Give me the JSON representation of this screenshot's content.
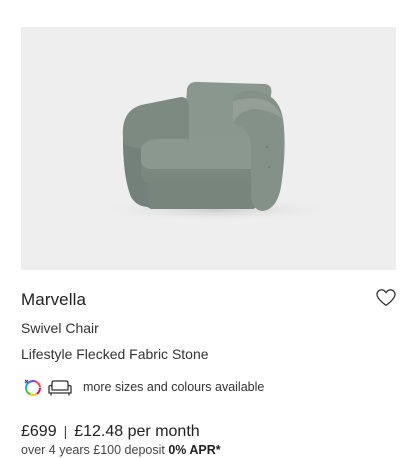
{
  "product": {
    "name": "Marvella",
    "type": "Swivel Chair",
    "variant": "Lifestyle Flecked Fabric Stone",
    "options_text": "more sizes and colours available",
    "price": "£699",
    "separator": "|",
    "monthly": "£12.48 per month",
    "finance_terms": "over 4 years £100 deposit",
    "apr": "0% APR*"
  },
  "icons": {
    "wishlist": "heart-outline-icon",
    "colours": "colour-wheel-icon",
    "sizes": "sofa-outline-icon"
  },
  "colors": {
    "image_background": "#eeeeee",
    "chair_fabric": "#7e8b82"
  }
}
